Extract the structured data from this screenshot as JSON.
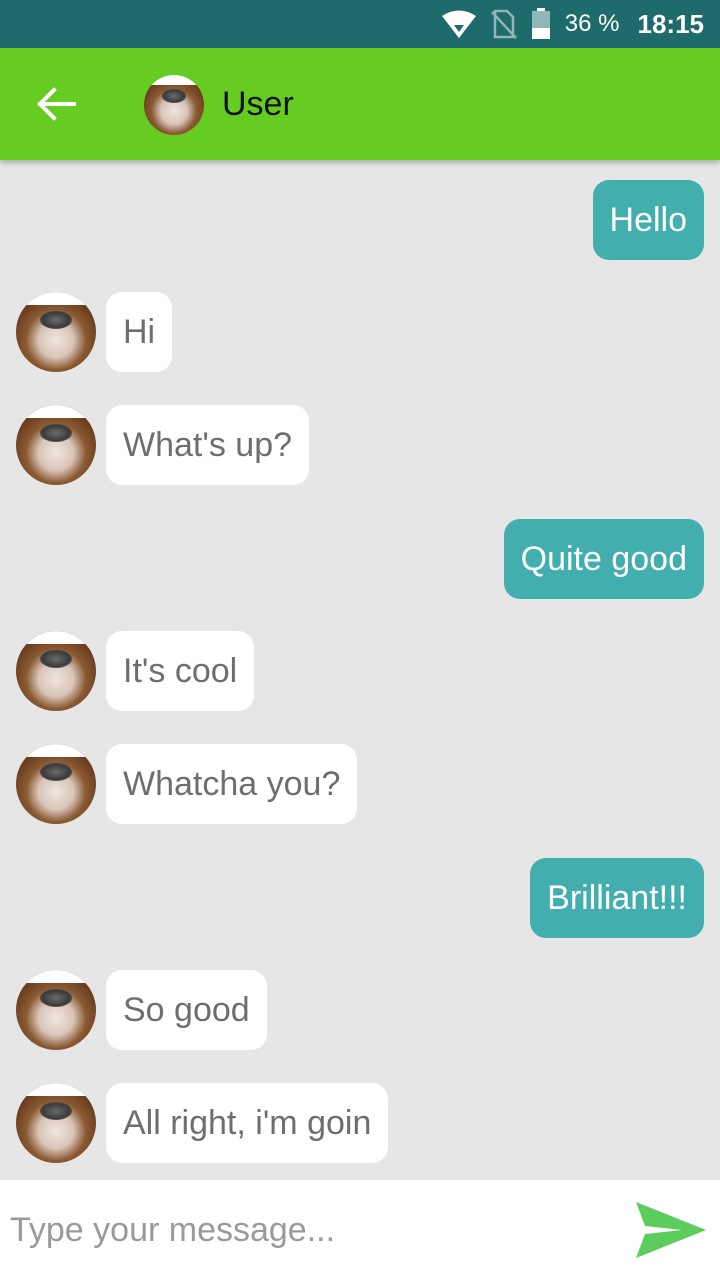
{
  "status_bar": {
    "battery_percent": "36 %",
    "time": "18:15",
    "icons": [
      "wifi-icon",
      "no-sim-icon",
      "battery-icon"
    ]
  },
  "header": {
    "title": "User",
    "back_icon": "arrow-left-icon"
  },
  "messages": [
    {
      "direction": "outgoing",
      "text": "Hello"
    },
    {
      "direction": "incoming",
      "text": "Hi"
    },
    {
      "direction": "incoming",
      "text": "What's up?"
    },
    {
      "direction": "outgoing",
      "text": "Quite good"
    },
    {
      "direction": "incoming",
      "text": "It's cool"
    },
    {
      "direction": "incoming",
      "text": "Whatcha you?"
    },
    {
      "direction": "outgoing",
      "text": "Brilliant!!!"
    },
    {
      "direction": "incoming",
      "text": "So good"
    },
    {
      "direction": "incoming",
      "text": "All right, i'm goin"
    }
  ],
  "composer": {
    "placeholder": "Type your message...",
    "value": "",
    "send_icon": "send-icon"
  },
  "colors": {
    "status_bar": "#1e6b6b",
    "app_bar": "#66cc22",
    "outgoing_bubble": "#43aeae",
    "incoming_bubble": "#ffffff",
    "chat_background": "#e6e6e6",
    "send_icon": "#5ccc5c"
  }
}
